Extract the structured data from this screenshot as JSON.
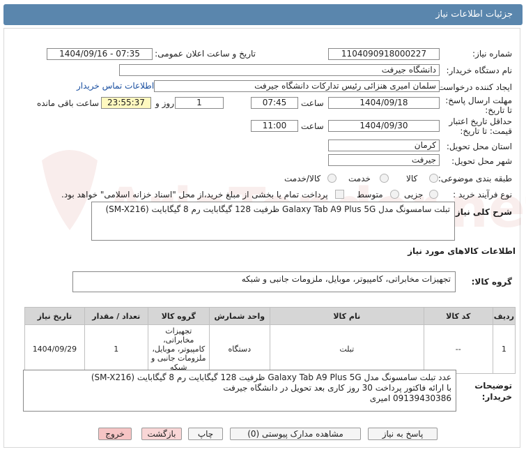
{
  "header": {
    "title": "جزئیات اطلاعات نیاز"
  },
  "fields": {
    "need_number_label": "شماره نیاز:",
    "need_number": "1104090918000227",
    "announce_label": "تاریخ و ساعت اعلان عمومی:",
    "announce_value": "1404/09/16 - 07:35",
    "buyer_label": "نام دستگاه خریدار:",
    "buyer_value": "دانشگاه جیرفت",
    "creator_label": "ایجاد کننده درخواست:",
    "creator_value": "سلمان امیری هنزائی رئیس تدارکات دانشگاه جیرفت",
    "contact_link": "اطلاعات تماس خریدار",
    "deadline_label": "مهلت ارسال پاسخ: تا تاریخ:",
    "deadline_date": "1404/09/18",
    "time_label": "ساعت",
    "deadline_time": "07:45",
    "days_value": "1",
    "days_label": "روز و",
    "remaining_time": "23:55:37",
    "remaining_label": "ساعت باقی مانده",
    "validity_label": "حداقل تاریخ اعتبار قیمت: تا تاریخ:",
    "validity_date": "1404/09/30",
    "validity_time": "11:00",
    "province_label": "استان محل تحویل:",
    "province_value": "کرمان",
    "city_label": "شهر محل تحویل:",
    "city_value": "جیرفت",
    "category_label": "طبقه بندی موضوعی:",
    "category_options": [
      "کالا",
      "خدمت",
      "کالا/خدمت"
    ],
    "process_label": "نوع فرآیند خرید :",
    "process_options": [
      "جزیی",
      "متوسط"
    ],
    "payment_note": "پرداخت تمام یا بخشی از مبلغ خرید،از محل \"اسناد خزانه اسلامی\" خواهد بود."
  },
  "summary": {
    "label": "شرح کلی نیاز:",
    "value": "تبلت سامسونگ مدل Galaxy Tab A9 Plus 5G ظرفیت 128 گیگابایت رم 8 گیگابایت (SM-X216)"
  },
  "goods_section_title": "اطلاعات کالاهای مورد نیاز",
  "goods_group": {
    "label": "گروه کالا:",
    "value": "تجهیزات مخابراتی، کامپیوتر، موبایل، ملزومات جانبی و شبکه"
  },
  "table": {
    "headers": [
      "ردیف",
      "کد کالا",
      "نام کالا",
      "واحد شمارش",
      "گروه کالا",
      "تعداد / مقدار",
      "تاریخ نیاز"
    ],
    "rows": [
      [
        "1",
        "--",
        "تبلت",
        "دستگاه",
        "تجهیزات مخابراتی، کامپیوتر، موبایل، ملزومات جانبی و شبکه",
        "1",
        "1404/09/29"
      ]
    ]
  },
  "notes": {
    "label": "توضیحات خریدار:",
    "line1": "عدد تبلت سامسونگ مدل Galaxy Tab A9 Plus 5G ظرفیت 128 گیگابایت رم 8 گیگابایت (SM-X216)",
    "line2": "با ارائه فاکتور پرداخت 30 روز کاری بعد تحویل در دانشگاه جیرفت",
    "line3": "09139430386 امیری"
  },
  "buttons": {
    "reply": "پاسخ به نیاز",
    "attachments": "مشاهده مدارک پیوستی (0)",
    "print": "چاپ",
    "back": "بازگشت",
    "exit": "خروج"
  },
  "watermark_text": "AriaTender.net",
  "colors": {
    "header": "#5a86ad",
    "timer_bg": "#fff9c0",
    "link": "#1a4fa0",
    "back_bg": "#f9d6d6",
    "exit_bg": "#f6c4c4"
  }
}
